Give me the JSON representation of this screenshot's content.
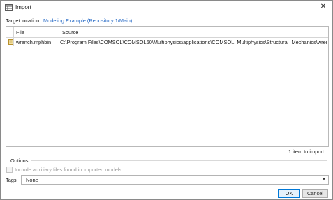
{
  "window": {
    "title": "Import",
    "title_icon": "import-table-icon",
    "close_icon": "close-icon"
  },
  "target": {
    "label": "Target location:",
    "value": "Modeling Example (Repository 1/Main)"
  },
  "table": {
    "columns": [
      "File",
      "Source"
    ],
    "rows": [
      {
        "icon": "mph-file-icon",
        "file": "wrench.mphbin",
        "source": "C:\\Program Files\\COMSOL\\COMSOL60\\Multiphysics\\applications\\COMSOL_Multiphysics\\Structural_Mechanics\\wrench..."
      }
    ]
  },
  "status": {
    "count_text": "1 item to import."
  },
  "options": {
    "label": "Options",
    "include_aux_label": "Include auxiliary files found in imported models",
    "include_aux_checked": false
  },
  "tags": {
    "label": "Tags:",
    "value": "None"
  },
  "buttons": {
    "ok": "OK",
    "cancel": "Cancel"
  },
  "colors": {
    "link": "#2166c4",
    "default_button_border": "#0078d7"
  }
}
